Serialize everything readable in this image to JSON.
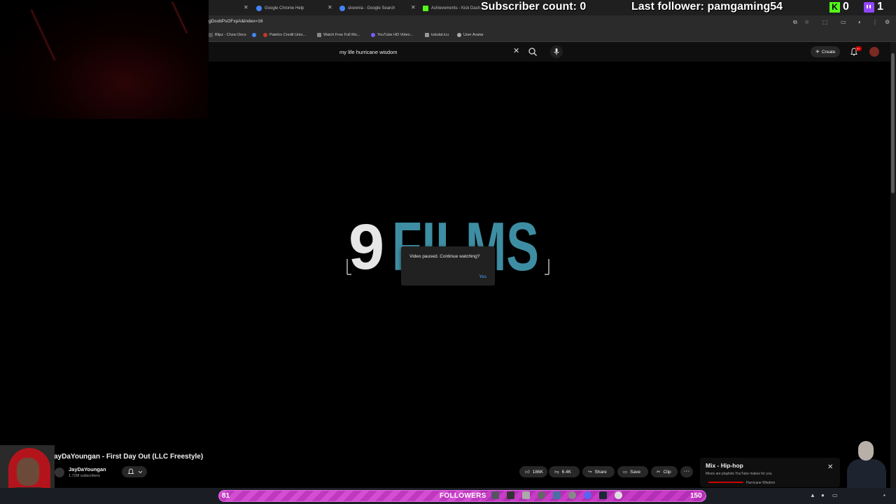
{
  "browser": {
    "tabs": [
      {
        "label": "Google Chrome Help",
        "icon": "google-icon"
      },
      {
        "label": "slovenia - Google Search",
        "icon": "google-icon"
      },
      {
        "label": "Achievements - Kick Dash",
        "icon": "kick-icon"
      }
    ],
    "url": "gDsobPsOFxpA&index=16",
    "bookmarks": [
      {
        "label": "Blipz - Chzw Docs"
      },
      {
        "label": ""
      },
      {
        "label": "Patelco Credit Unio..."
      },
      {
        "label": "Watch Free Full Mo..."
      },
      {
        "label": "YouTube HD Video..."
      },
      {
        "label": "tubulat.icu"
      },
      {
        "label": "User Avatar"
      }
    ]
  },
  "youtube": {
    "search_query": "my life hurricane wisdom",
    "create_label": "Create",
    "notification_badge": "9+",
    "dialog": {
      "message": "Video paused. Continue watching?",
      "yes_label": "Yes"
    },
    "logo": {
      "number": "9",
      "word": "FILMS"
    },
    "video_title": "ayDaYoungan - First Day Out (LLC Freestyle)",
    "channel_name": "JayDaYoungan",
    "subscribers": "1.72M subscribers",
    "actions": {
      "likes": "186K",
      "dislikes": "6.4K",
      "share": "Share",
      "save": "Save",
      "clip": "Clip"
    },
    "mix": {
      "title": "Mix - Hip-hop",
      "subtitle": "Mixes are playlists YouTube makes for you",
      "track": "Hurricane Wisdom"
    }
  },
  "overlay": {
    "subscriber_count": "Subscriber count: 0",
    "last_follower": "Last follower: pamgaming54",
    "kick_count": "0",
    "twitch_count": "1",
    "followers_label": "FOLLOWERS",
    "followers_current": "81",
    "followers_goal": "150",
    "followers_fraction": 0.54
  },
  "colors": {
    "accent_blue": "#3ea6ff",
    "logo_teal": "#3e8ea3",
    "followers_bar": "#c83cc8",
    "kick_green": "#53fc18",
    "twitch_purple": "#9146ff"
  }
}
